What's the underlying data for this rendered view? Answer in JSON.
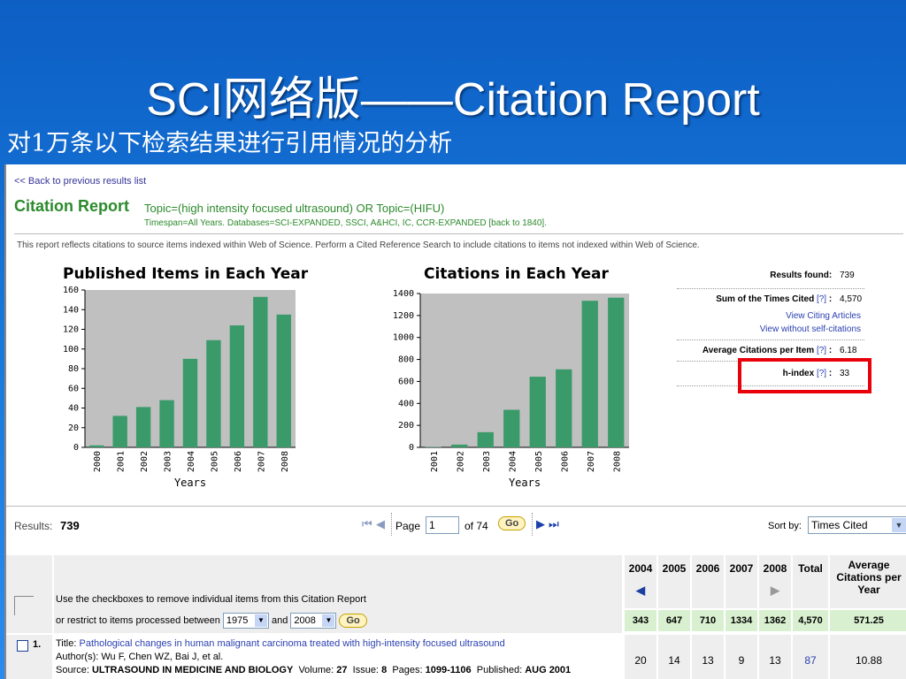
{
  "slide": {
    "title": "SCI网络版——Citation Report",
    "subtitle": "对1万条以下检索结果进行引用情况的分析"
  },
  "report": {
    "back_link": "<< Back to previous results list",
    "title": "Citation Report",
    "topic": "Topic=(high intensity focused ultrasound) OR Topic=(HIFU)",
    "timespan": "Timespan=All Years. Databases=SCI-EXPANDED, SSCI, A&HCI, IC, CCR-EXPANDED [back to 1840].",
    "note": "This report reflects citations to source items indexed within Web of Science. Perform a Cited Reference Search to include citations to items not indexed within Web of Science."
  },
  "chart_data": [
    {
      "type": "bar",
      "title": "Published Items in Each Year",
      "xlabel": "Years",
      "ylabel": "",
      "categories": [
        "2000",
        "2001",
        "2002",
        "2003",
        "2004",
        "2005",
        "2006",
        "2007",
        "2008"
      ],
      "values": [
        2,
        32,
        41,
        48,
        90,
        109,
        124,
        153,
        135
      ],
      "ylim": [
        0,
        160
      ],
      "yticks": [
        "0",
        "20",
        "40",
        "60",
        "80",
        "100",
        "120",
        "140",
        "160"
      ],
      "grid": false,
      "bar_color": "#3a9a6a"
    },
    {
      "type": "bar",
      "title": "Citations in Each Year",
      "xlabel": "Years",
      "ylabel": "",
      "categories": [
        "2001",
        "2002",
        "2003",
        "2004",
        "2005",
        "2006",
        "2007",
        "2008"
      ],
      "values": [
        4,
        25,
        138,
        342,
        643,
        710,
        1334,
        1362
      ],
      "ylim": [
        0,
        1400
      ],
      "yticks": [
        "0",
        "200",
        "400",
        "600",
        "800",
        "1000",
        "1200",
        "1400"
      ],
      "grid": false,
      "bar_color": "#3a9a6a"
    }
  ],
  "stats": {
    "results_found_label": "Results found:",
    "results_found": "739",
    "sum_label": "Sum of the Times Cited",
    "help": "[?]",
    "sum_value": "4,570",
    "view_citing": "View Citing Articles",
    "view_without": "View without self-citations",
    "avg_label": "Average Citations per Item",
    "avg_value": "6.18",
    "hindex_label": "h-index",
    "hindex_value": "33",
    "colon": ":"
  },
  "results_bar": {
    "label": "Results:",
    "count": "739",
    "page_label": "Page",
    "page_value": "1",
    "of_label": "of 74",
    "go": "Go",
    "sort_label": "Sort by:",
    "sort_value": "Times Cited"
  },
  "grid": {
    "instruction": "Use the checkboxes to remove individual items from this Citation Report",
    "restrict": "or restrict to items processed between",
    "from_year": "1975",
    "and_label": "and",
    "to_year": "2008",
    "go": "Go",
    "years": [
      "2004",
      "2005",
      "2006",
      "2007",
      "2008"
    ],
    "total_label": "Total",
    "avg_header": "Average Citations per Year",
    "totals": [
      "343",
      "647",
      "710",
      "1334",
      "1362",
      "4,570",
      "571.25"
    ]
  },
  "record": {
    "number": "1.",
    "title_label": "Title:",
    "title": "Pathological changes in human malignant carcinoma treated with high-intensity focused ultrasound",
    "authors_label": "Author(s):",
    "authors": "Wu F, Chen WZ, Bai J, et al.",
    "source_label": "Source:",
    "source": "ULTRASOUND IN MEDICINE AND BIOLOGY",
    "volume_label": "Volume:",
    "volume": "27",
    "issue_label": "Issue:",
    "issue": "8",
    "pages_label": "Pages:",
    "pages": "1099-1106",
    "published_label": "Published:",
    "published": "AUG 2001",
    "cites": [
      "20",
      "14",
      "13",
      "9",
      "13"
    ],
    "total": "87",
    "avg": "10.88"
  }
}
